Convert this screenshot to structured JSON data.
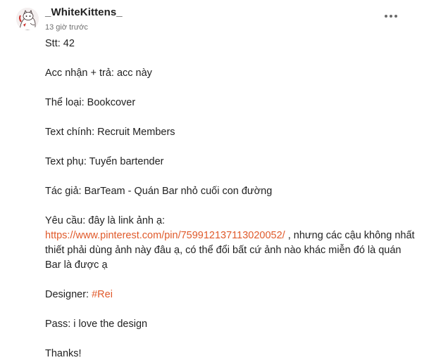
{
  "comment": {
    "author": "_WhiteKittens_",
    "timestamp": "13 giờ trước",
    "avatar_icon": "cat-avatar-icon",
    "more_icon": "more-options-icon",
    "lines": {
      "stt": "Stt: 42",
      "acc": "Acc nhận + trả: acc này",
      "the_loai": "Thể loại: Bookcover",
      "text_chinh": "Text chính: Recruit Members",
      "text_phu": "Text phụ: Tuyển bartender",
      "tac_gia": "Tác giả: BarTeam - Quán Bar nhỏ cuối con đường",
      "yeu_cau_label": "Yêu cầu: đây là link ảnh ạ:",
      "yeu_cau_link": "https://www.pinterest.com/pin/759912137113020052/",
      "yeu_cau_rest": " , nhưng các cậu không nhất thiết phải dùng ảnh này đâu ạ, có thể đổi bất cứ ảnh nào khác miễn đó là quán Bar là được ạ",
      "designer_label": "Designer: ",
      "designer_tag": "#Rei",
      "pass": "Pass: i love the design",
      "thanks": "Thanks!"
    }
  },
  "colors": {
    "link": "#e05a2b",
    "text": "#222222",
    "muted": "#6f6f6f"
  }
}
